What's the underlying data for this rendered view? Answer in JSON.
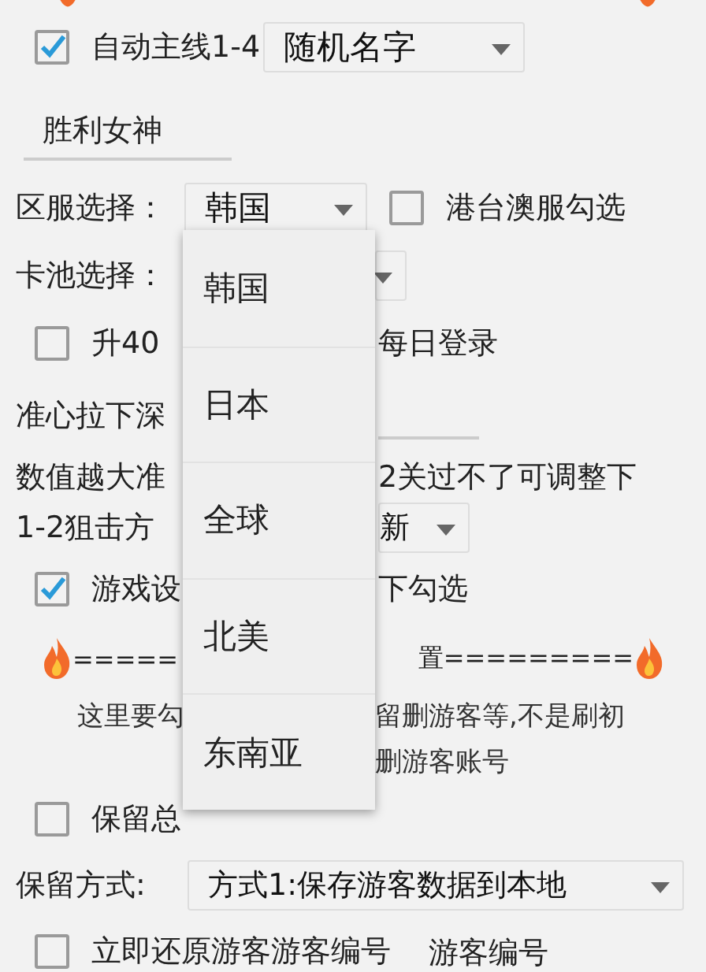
{
  "rows": [
    {
      "kind": "check_select",
      "checked": true,
      "label": "自动主线1-4",
      "value": "随机名字"
    },
    {
      "kind": "field",
      "value": "胜利女神"
    },
    {
      "kind": "region",
      "label": "区服选择：",
      "value": "韩国",
      "check_label": "港台澳服勾选",
      "checked": false
    },
    {
      "kind": "pool",
      "label": "卡池选择："
    },
    {
      "kind": "check_split",
      "checked": false,
      "left": "升40",
      "right": "每日登录"
    },
    {
      "kind": "label_field",
      "left": "准心拉下深"
    },
    {
      "kind": "split",
      "left": "数值越大准",
      "right": "2关过不了可调整下"
    },
    {
      "kind": "split_select",
      "left": "1-2狙击方",
      "value": "新"
    },
    {
      "kind": "check_split",
      "checked": true,
      "left": "游戏设",
      "right": "下勾选"
    },
    {
      "kind": "banner",
      "left": "=====",
      "right": "置========="
    },
    {
      "kind": "note",
      "left": "这里要勾",
      "right": "留删游客等,不是刷初"
    },
    {
      "kind": "note",
      "left": "",
      "right": "删游客账号"
    },
    {
      "kind": "check",
      "checked": false,
      "label": "保留总"
    },
    {
      "kind": "label_select",
      "label": "保留方式:",
      "value": "方式1:保存游客数据到本地"
    },
    {
      "kind": "check_field",
      "checked": false,
      "label": "立即还原游客游客编号",
      "value": "游客编号"
    }
  ],
  "menu": {
    "items": [
      "韩国",
      "日本",
      "全球",
      "北美",
      "东南亚"
    ]
  }
}
